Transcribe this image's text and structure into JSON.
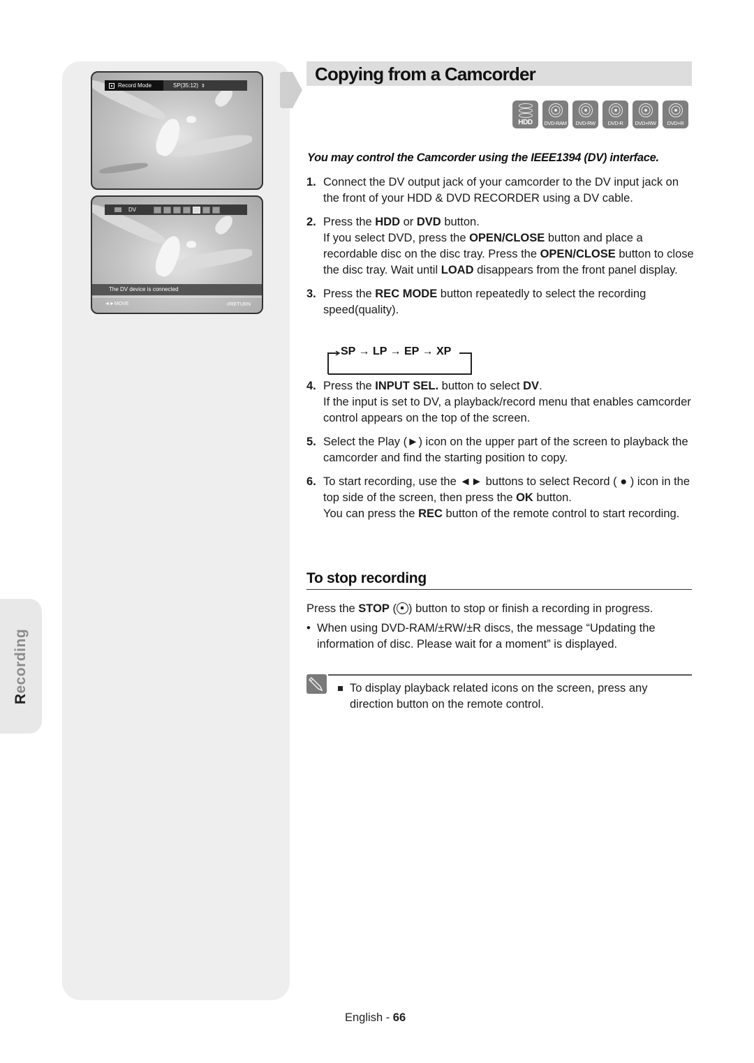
{
  "side_tab": {
    "label_first": "R",
    "label_rest": "ecording"
  },
  "screens": {
    "record_mode": {
      "label": "Record Mode",
      "value": "SP(35:12)",
      "updown_glyph": "⇕"
    },
    "dv_menu": {
      "label": "DV",
      "buttons": [
        "rewind",
        "stop",
        "frame-back",
        "slow",
        "play",
        "frame-fwd",
        "record"
      ],
      "selected_button_index": 4,
      "message": "The DV device is connected",
      "move_label": "◄►MOVE",
      "return_label": "RETURN",
      "return_glyph": "↺"
    }
  },
  "header": {
    "title": "Copying from a Camcorder"
  },
  "disc_types": [
    {
      "label": "HDD",
      "icon": "hdd-icon"
    },
    {
      "label": "DVD-RAM",
      "icon": "disc-icon"
    },
    {
      "label": "DVD-RW",
      "icon": "disc-icon"
    },
    {
      "label": "DVD-R",
      "icon": "disc-icon"
    },
    {
      "label": "DVD+RW",
      "icon": "disc-icon"
    },
    {
      "label": "DVD+R",
      "icon": "disc-icon"
    }
  ],
  "subtitle": "You may control the Camcorder using the IEEE1394 (DV) interface.",
  "steps": [
    {
      "num": "1.",
      "text": "Connect the DV output jack of your camcorder to the DV input jack on the front of your HDD & DVD RECORDER using a DV cable."
    },
    {
      "num": "2.",
      "p1": "Press the ",
      "b1": "HDD",
      "p2": " or ",
      "b2": "DVD",
      "p3": " button.",
      "l2a": "If you select DVD, press the ",
      "l2b": "OPEN/CLOSE",
      "l2c": " button and place a recordable disc on the disc tray. Press the ",
      "l2d": "OPEN/CLOSE",
      "l2e": " button to close the disc tray. Wait until ",
      "l2f": "LOAD",
      "l2g": " disappears from the front panel display."
    },
    {
      "num": "3.",
      "p1": "Press the ",
      "b1": "REC MODE",
      "p2": " button repeatedly to select the recording speed(quality)."
    },
    {
      "num": "4.",
      "p1": "Press the ",
      "b1": "INPUT SEL.",
      "p2": " button to select ",
      "b2": "DV",
      "p3": ".",
      "l2": "If the input is set to DV, a playback/record menu that enables camcorder control appears on the top of the screen."
    },
    {
      "num": "5.",
      "text": "Select the Play (►) icon on the upper part of the screen to playback the camcorder and find the starting position to copy."
    },
    {
      "num": "6.",
      "p1": "To start recording, use the ◄► buttons to select Record ( ● ) icon in the top side of the screen, then press the ",
      "b1": "OK",
      "p2": " button.",
      "l2a": "You can press the ",
      "l2b": "REC",
      "l2c": " button of the remote control to start recording."
    }
  ],
  "record_modes": {
    "text": "SP → LP → EP → XP",
    "modes": [
      "SP",
      "LP",
      "EP",
      "XP"
    ]
  },
  "stop_section": {
    "heading": "To stop recording",
    "p1": "Press the ",
    "b1": "STOP",
    "p2": " (",
    "p3": ") button to stop or finish a recording in progress.",
    "bullet": "When using DVD-RAM/±RW/±R discs, the message “Updating the information of disc. Please wait for a moment” is displayed."
  },
  "note": {
    "text": "To display playback related icons on the screen, press any direction button on the remote control."
  },
  "footer": {
    "language": "English",
    "separator": " - ",
    "page": "66"
  }
}
